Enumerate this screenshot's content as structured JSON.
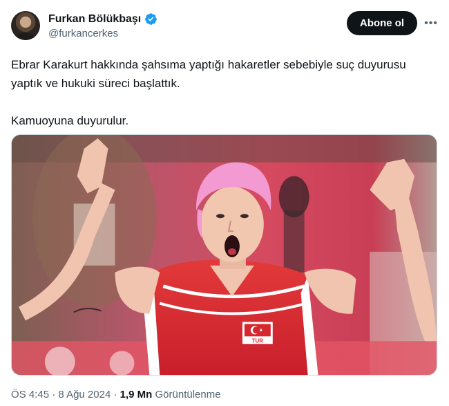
{
  "author": {
    "display_name": "Furkan Bölükbaşı",
    "handle": "@furkancerkes",
    "verified_color": "#1d9bf0"
  },
  "actions": {
    "follow_label": "Abone ol",
    "more_icon": "more-horizontal-icon"
  },
  "tweet": {
    "paragraphs": [
      "Ebrar Karakurt hakkında şahsıma yaptığı hakaretler sebebiyle suç duyurusu yaptık ve hukuki süreci başlattık.",
      "Kamuoyuna duyurulur."
    ]
  },
  "media": {
    "jersey_text": "TUR"
  },
  "meta": {
    "time": "ÖS 4:45",
    "separator": " · ",
    "date": "8 Ağu 2024",
    "views_count": "1,9 Mn",
    "views_label": " Görüntülenme"
  },
  "colors": {
    "text": "#0f1419",
    "secondary": "#536471",
    "button_bg": "#0f1419",
    "jersey_red": "#d8262f"
  }
}
